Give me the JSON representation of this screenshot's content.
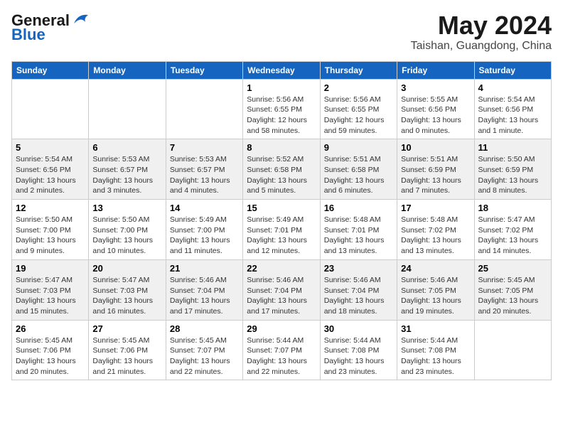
{
  "header": {
    "logo_general": "General",
    "logo_blue": "Blue",
    "month_year": "May 2024",
    "location": "Taishan, Guangdong, China"
  },
  "weekdays": [
    "Sunday",
    "Monday",
    "Tuesday",
    "Wednesday",
    "Thursday",
    "Friday",
    "Saturday"
  ],
  "weeks": [
    [
      {
        "day": "",
        "info": ""
      },
      {
        "day": "",
        "info": ""
      },
      {
        "day": "",
        "info": ""
      },
      {
        "day": "1",
        "info": "Sunrise: 5:56 AM\nSunset: 6:55 PM\nDaylight: 12 hours\nand 58 minutes."
      },
      {
        "day": "2",
        "info": "Sunrise: 5:56 AM\nSunset: 6:55 PM\nDaylight: 12 hours\nand 59 minutes."
      },
      {
        "day": "3",
        "info": "Sunrise: 5:55 AM\nSunset: 6:56 PM\nDaylight: 13 hours\nand 0 minutes."
      },
      {
        "day": "4",
        "info": "Sunrise: 5:54 AM\nSunset: 6:56 PM\nDaylight: 13 hours\nand 1 minute."
      }
    ],
    [
      {
        "day": "5",
        "info": "Sunrise: 5:54 AM\nSunset: 6:56 PM\nDaylight: 13 hours\nand 2 minutes."
      },
      {
        "day": "6",
        "info": "Sunrise: 5:53 AM\nSunset: 6:57 PM\nDaylight: 13 hours\nand 3 minutes."
      },
      {
        "day": "7",
        "info": "Sunrise: 5:53 AM\nSunset: 6:57 PM\nDaylight: 13 hours\nand 4 minutes."
      },
      {
        "day": "8",
        "info": "Sunrise: 5:52 AM\nSunset: 6:58 PM\nDaylight: 13 hours\nand 5 minutes."
      },
      {
        "day": "9",
        "info": "Sunrise: 5:51 AM\nSunset: 6:58 PM\nDaylight: 13 hours\nand 6 minutes."
      },
      {
        "day": "10",
        "info": "Sunrise: 5:51 AM\nSunset: 6:59 PM\nDaylight: 13 hours\nand 7 minutes."
      },
      {
        "day": "11",
        "info": "Sunrise: 5:50 AM\nSunset: 6:59 PM\nDaylight: 13 hours\nand 8 minutes."
      }
    ],
    [
      {
        "day": "12",
        "info": "Sunrise: 5:50 AM\nSunset: 7:00 PM\nDaylight: 13 hours\nand 9 minutes."
      },
      {
        "day": "13",
        "info": "Sunrise: 5:50 AM\nSunset: 7:00 PM\nDaylight: 13 hours\nand 10 minutes."
      },
      {
        "day": "14",
        "info": "Sunrise: 5:49 AM\nSunset: 7:00 PM\nDaylight: 13 hours\nand 11 minutes."
      },
      {
        "day": "15",
        "info": "Sunrise: 5:49 AM\nSunset: 7:01 PM\nDaylight: 13 hours\nand 12 minutes."
      },
      {
        "day": "16",
        "info": "Sunrise: 5:48 AM\nSunset: 7:01 PM\nDaylight: 13 hours\nand 13 minutes."
      },
      {
        "day": "17",
        "info": "Sunrise: 5:48 AM\nSunset: 7:02 PM\nDaylight: 13 hours\nand 13 minutes."
      },
      {
        "day": "18",
        "info": "Sunrise: 5:47 AM\nSunset: 7:02 PM\nDaylight: 13 hours\nand 14 minutes."
      }
    ],
    [
      {
        "day": "19",
        "info": "Sunrise: 5:47 AM\nSunset: 7:03 PM\nDaylight: 13 hours\nand 15 minutes."
      },
      {
        "day": "20",
        "info": "Sunrise: 5:47 AM\nSunset: 7:03 PM\nDaylight: 13 hours\nand 16 minutes."
      },
      {
        "day": "21",
        "info": "Sunrise: 5:46 AM\nSunset: 7:04 PM\nDaylight: 13 hours\nand 17 minutes."
      },
      {
        "day": "22",
        "info": "Sunrise: 5:46 AM\nSunset: 7:04 PM\nDaylight: 13 hours\nand 17 minutes."
      },
      {
        "day": "23",
        "info": "Sunrise: 5:46 AM\nSunset: 7:04 PM\nDaylight: 13 hours\nand 18 minutes."
      },
      {
        "day": "24",
        "info": "Sunrise: 5:46 AM\nSunset: 7:05 PM\nDaylight: 13 hours\nand 19 minutes."
      },
      {
        "day": "25",
        "info": "Sunrise: 5:45 AM\nSunset: 7:05 PM\nDaylight: 13 hours\nand 20 minutes."
      }
    ],
    [
      {
        "day": "26",
        "info": "Sunrise: 5:45 AM\nSunset: 7:06 PM\nDaylight: 13 hours\nand 20 minutes."
      },
      {
        "day": "27",
        "info": "Sunrise: 5:45 AM\nSunset: 7:06 PM\nDaylight: 13 hours\nand 21 minutes."
      },
      {
        "day": "28",
        "info": "Sunrise: 5:45 AM\nSunset: 7:07 PM\nDaylight: 13 hours\nand 22 minutes."
      },
      {
        "day": "29",
        "info": "Sunrise: 5:44 AM\nSunset: 7:07 PM\nDaylight: 13 hours\nand 22 minutes."
      },
      {
        "day": "30",
        "info": "Sunrise: 5:44 AM\nSunset: 7:08 PM\nDaylight: 13 hours\nand 23 minutes."
      },
      {
        "day": "31",
        "info": "Sunrise: 5:44 AM\nSunset: 7:08 PM\nDaylight: 13 hours\nand 23 minutes."
      },
      {
        "day": "",
        "info": ""
      }
    ]
  ]
}
